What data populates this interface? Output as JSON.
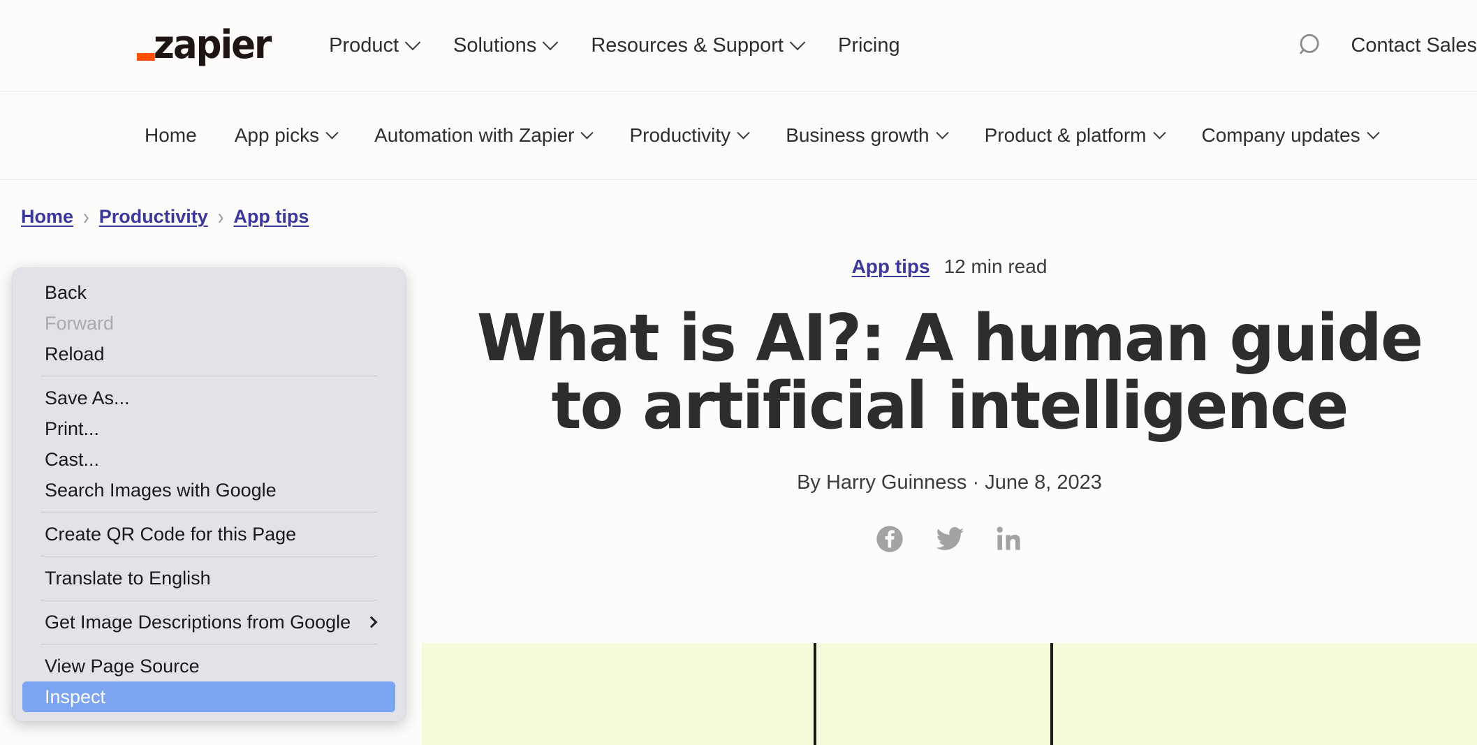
{
  "brand": {
    "logo_text": "zapier",
    "accent_color": "#ff4f00"
  },
  "primary_nav": {
    "items": [
      {
        "label": "Product",
        "has_chevron": true
      },
      {
        "label": "Solutions",
        "has_chevron": true
      },
      {
        "label": "Resources & Support",
        "has_chevron": true
      },
      {
        "label": "Pricing",
        "has_chevron": false
      }
    ],
    "search_icon": "search-icon",
    "contact_sales_label": "Contact Sales"
  },
  "secondary_nav": {
    "items": [
      {
        "label": "Home",
        "has_chevron": false
      },
      {
        "label": "App picks",
        "has_chevron": true
      },
      {
        "label": "Automation with Zapier",
        "has_chevron": true
      },
      {
        "label": "Productivity",
        "has_chevron": true
      },
      {
        "label": "Business growth",
        "has_chevron": true
      },
      {
        "label": "Product & platform",
        "has_chevron": true
      },
      {
        "label": "Company updates",
        "has_chevron": true
      }
    ]
  },
  "breadcrumb": {
    "separator": "›",
    "items": [
      {
        "label": "Home"
      },
      {
        "label": "Productivity"
      },
      {
        "label": "App tips"
      }
    ]
  },
  "article": {
    "category": "App tips",
    "read_time": "12 min read",
    "title": "What is AI?: A human guide to artificial intelligence",
    "byline": "By Harry Guinness · June 8, 2023",
    "share": [
      {
        "name": "facebook-share-icon"
      },
      {
        "name": "twitter-share-icon"
      },
      {
        "name": "linkedin-share-icon"
      }
    ],
    "hero_bg_color": "#f4fada"
  },
  "context_menu": {
    "highlight_color": "#7da4f0",
    "background_color": "#e4e2e9",
    "groups": [
      {
        "items": [
          {
            "label": "Back",
            "disabled": false,
            "submenu": false,
            "highlighted": false
          },
          {
            "label": "Forward",
            "disabled": true,
            "submenu": false,
            "highlighted": false
          },
          {
            "label": "Reload",
            "disabled": false,
            "submenu": false,
            "highlighted": false
          }
        ]
      },
      {
        "items": [
          {
            "label": "Save As...",
            "disabled": false,
            "submenu": false,
            "highlighted": false
          },
          {
            "label": "Print...",
            "disabled": false,
            "submenu": false,
            "highlighted": false
          },
          {
            "label": "Cast...",
            "disabled": false,
            "submenu": false,
            "highlighted": false
          },
          {
            "label": "Search Images with Google",
            "disabled": false,
            "submenu": false,
            "highlighted": false
          }
        ]
      },
      {
        "items": [
          {
            "label": "Create QR Code for this Page",
            "disabled": false,
            "submenu": false,
            "highlighted": false
          }
        ]
      },
      {
        "items": [
          {
            "label": "Translate to English",
            "disabled": false,
            "submenu": false,
            "highlighted": false
          }
        ]
      },
      {
        "items": [
          {
            "label": "Get Image Descriptions from Google",
            "disabled": false,
            "submenu": true,
            "highlighted": false
          }
        ]
      },
      {
        "items": [
          {
            "label": "View Page Source",
            "disabled": false,
            "submenu": false,
            "highlighted": false
          },
          {
            "label": "Inspect",
            "disabled": false,
            "submenu": false,
            "highlighted": true
          }
        ]
      }
    ]
  }
}
